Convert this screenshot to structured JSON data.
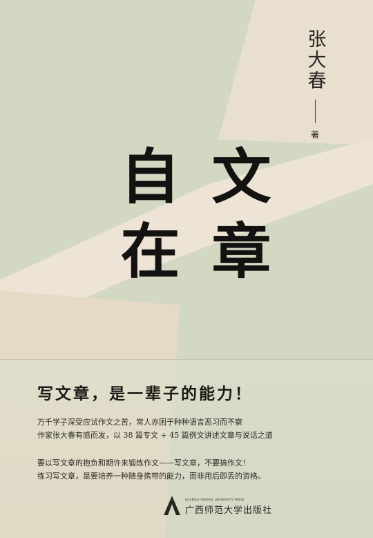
{
  "author": {
    "name": "张大春",
    "role": "著"
  },
  "title": {
    "column_right": "文章",
    "column_left": "自在"
  },
  "headline": "写文章，是一辈子的能力！",
  "description": {
    "paragraph1": [
      "万千学子深受应试作文之苦，常人亦困于种种语言恶习而不察",
      "作家张大春有感而发，以 38 篇专文 + 45 篇例文讲述文章与说话之道"
    ],
    "paragraph2": [
      "要以写文章的抱负和期许来锻炼作文——写文章，不要搞作文！",
      "练习写文章，是要培养一种随身携带的能力，而非用后即丢的资格。"
    ]
  },
  "publisher": {
    "english": "GUANGXI NORMAL UNIVERSITY PRESS",
    "chinese": "广西师范大学出版社",
    "logo_icon": "publisher-logo-icon"
  },
  "colors": {
    "background": "#d3d8c3",
    "beam": "#ede4d5",
    "ink": "#141210"
  }
}
